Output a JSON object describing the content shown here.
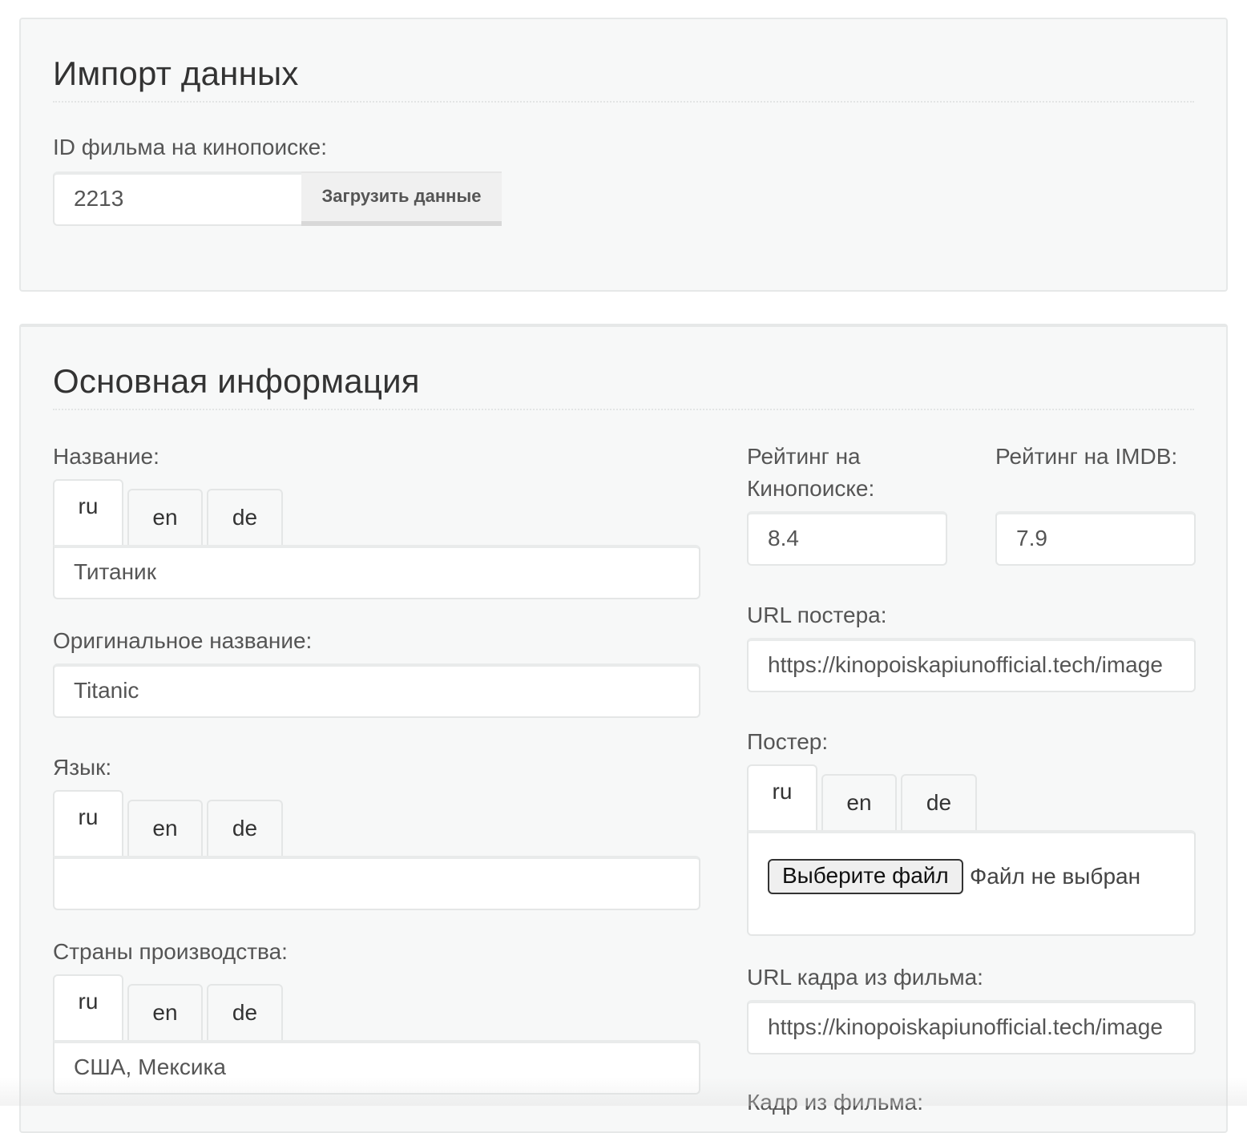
{
  "import": {
    "title": "Импорт данных",
    "id_label": "ID фильма на кинопоиске:",
    "id_value": "2213",
    "load_button": "Загрузить данные"
  },
  "main": {
    "title": "Основная информация",
    "lang_tabs": [
      "ru",
      "en",
      "de"
    ],
    "name": {
      "label": "Название:",
      "value": "Титаник"
    },
    "original_name": {
      "label": "Оригинальное название:",
      "value": "Titanic"
    },
    "language": {
      "label": "Язык:",
      "value": ""
    },
    "countries": {
      "label": "Страны производства:",
      "value": "США, Мексика"
    },
    "rating_kp": {
      "label_line1": "Рейтинг на",
      "label_line2": "Кинопоиске:",
      "value": "8.4"
    },
    "rating_imdb": {
      "label": "Рейтинг на IMDB:",
      "value": "7.9"
    },
    "poster_url": {
      "label": "URL постера:",
      "value": "https://kinopoiskapiunofficial.tech/image"
    },
    "poster": {
      "label": "Постер:",
      "choose_file": "Выберите файл",
      "no_file": "Файл не выбран"
    },
    "frame_url": {
      "label": "URL кадра из фильма:",
      "value": "https://kinopoiskapiunofficial.tech/image"
    },
    "frame": {
      "label": "Кадр из фильма:"
    }
  }
}
